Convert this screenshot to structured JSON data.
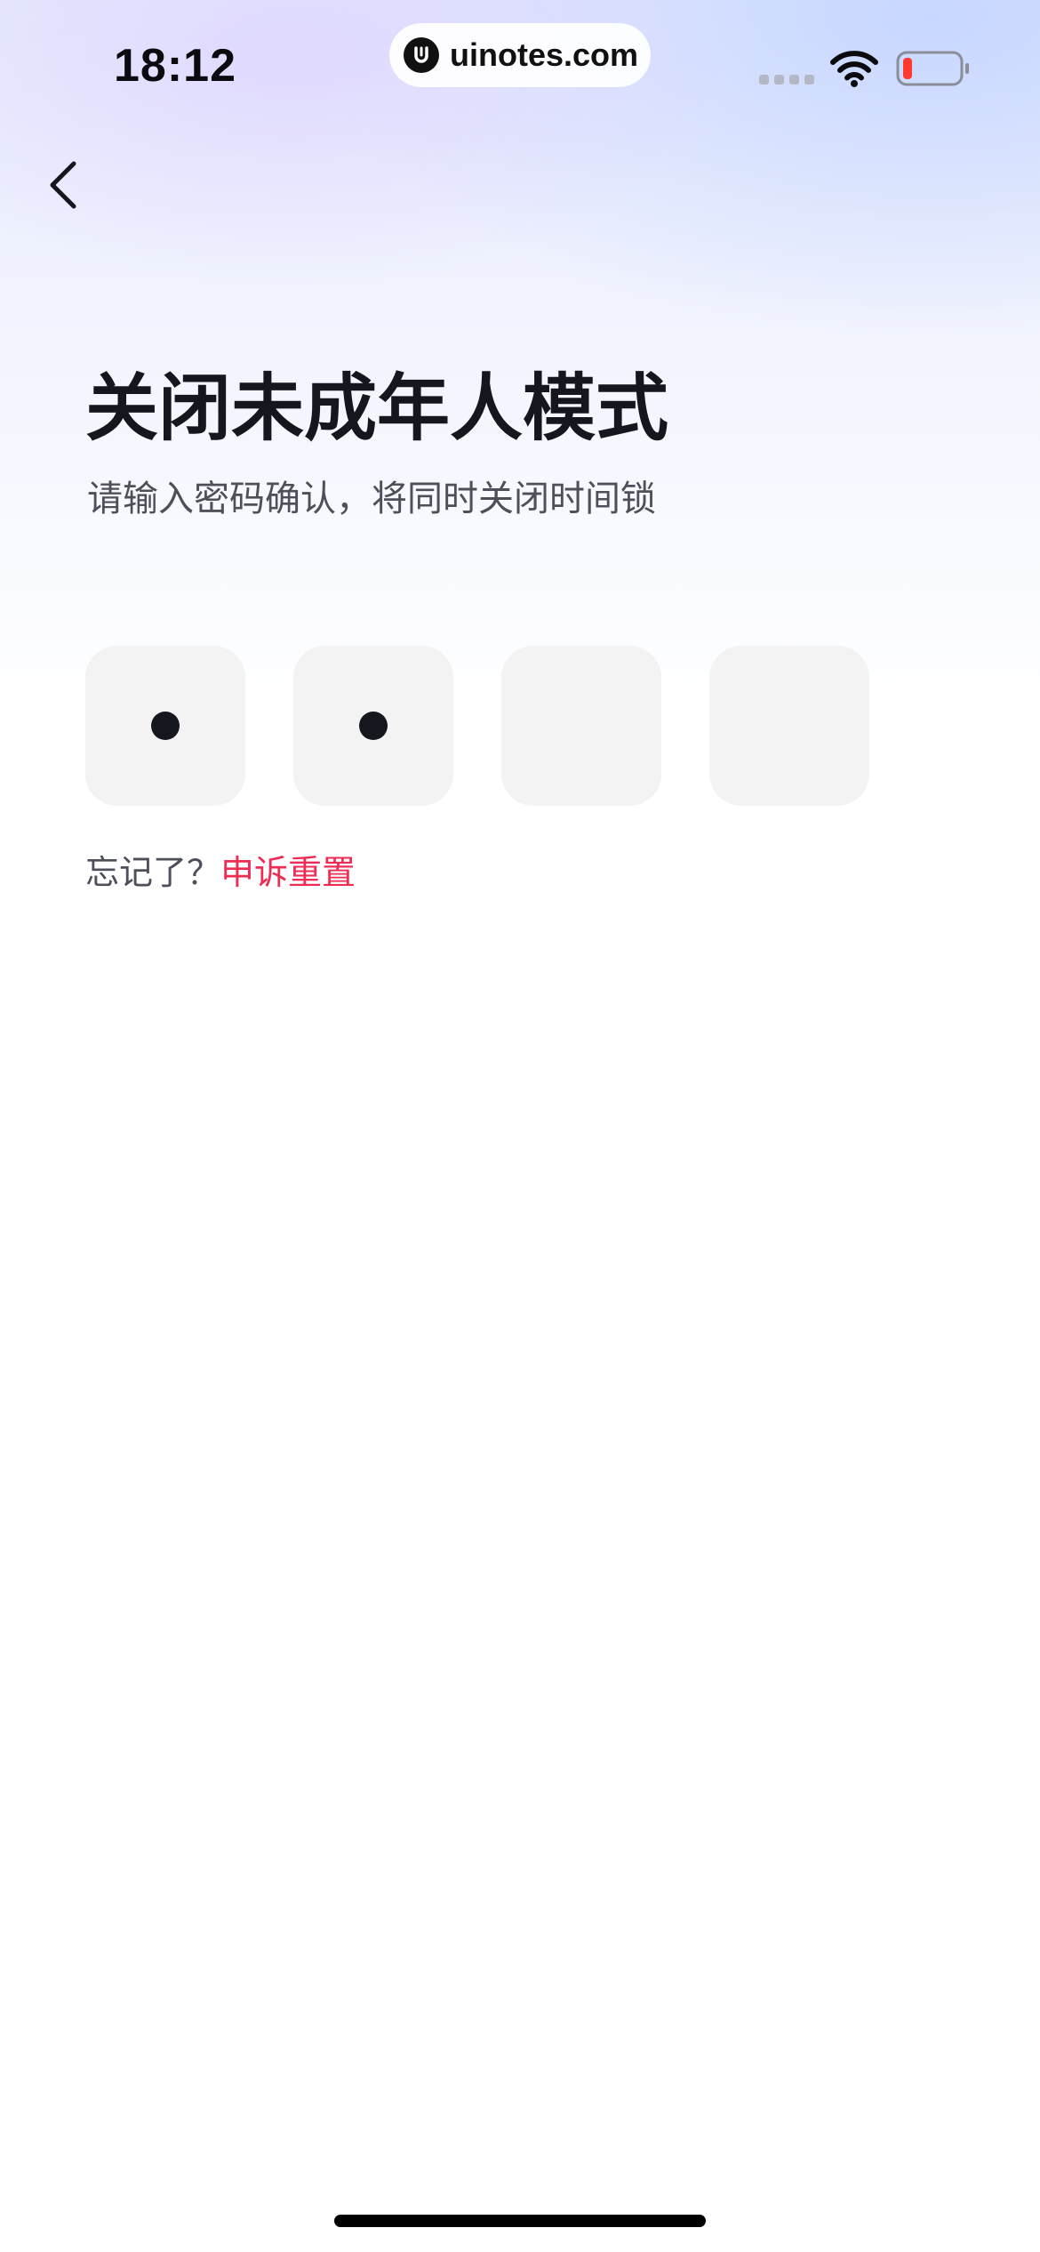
{
  "status_bar": {
    "time": "18:12",
    "url": "uinotes.com",
    "icons": [
      "signal-dots-icon",
      "wifi-icon",
      "battery-low-icon"
    ],
    "battery_color": "#ff3b30"
  },
  "nav": {
    "back_icon": "chevron-left-icon"
  },
  "header": {
    "title": "关闭未成年人模式",
    "subtitle": "请输入密码确认，将同时关闭时间锁"
  },
  "pin": {
    "length": 4,
    "filled": 2
  },
  "forgot": {
    "prompt": "忘记了？",
    "link": "申诉重置"
  },
  "colors": {
    "accent": "#ee2d55",
    "text": "#15171f",
    "muted": "#4d505a",
    "box": "#f3f3f4"
  }
}
